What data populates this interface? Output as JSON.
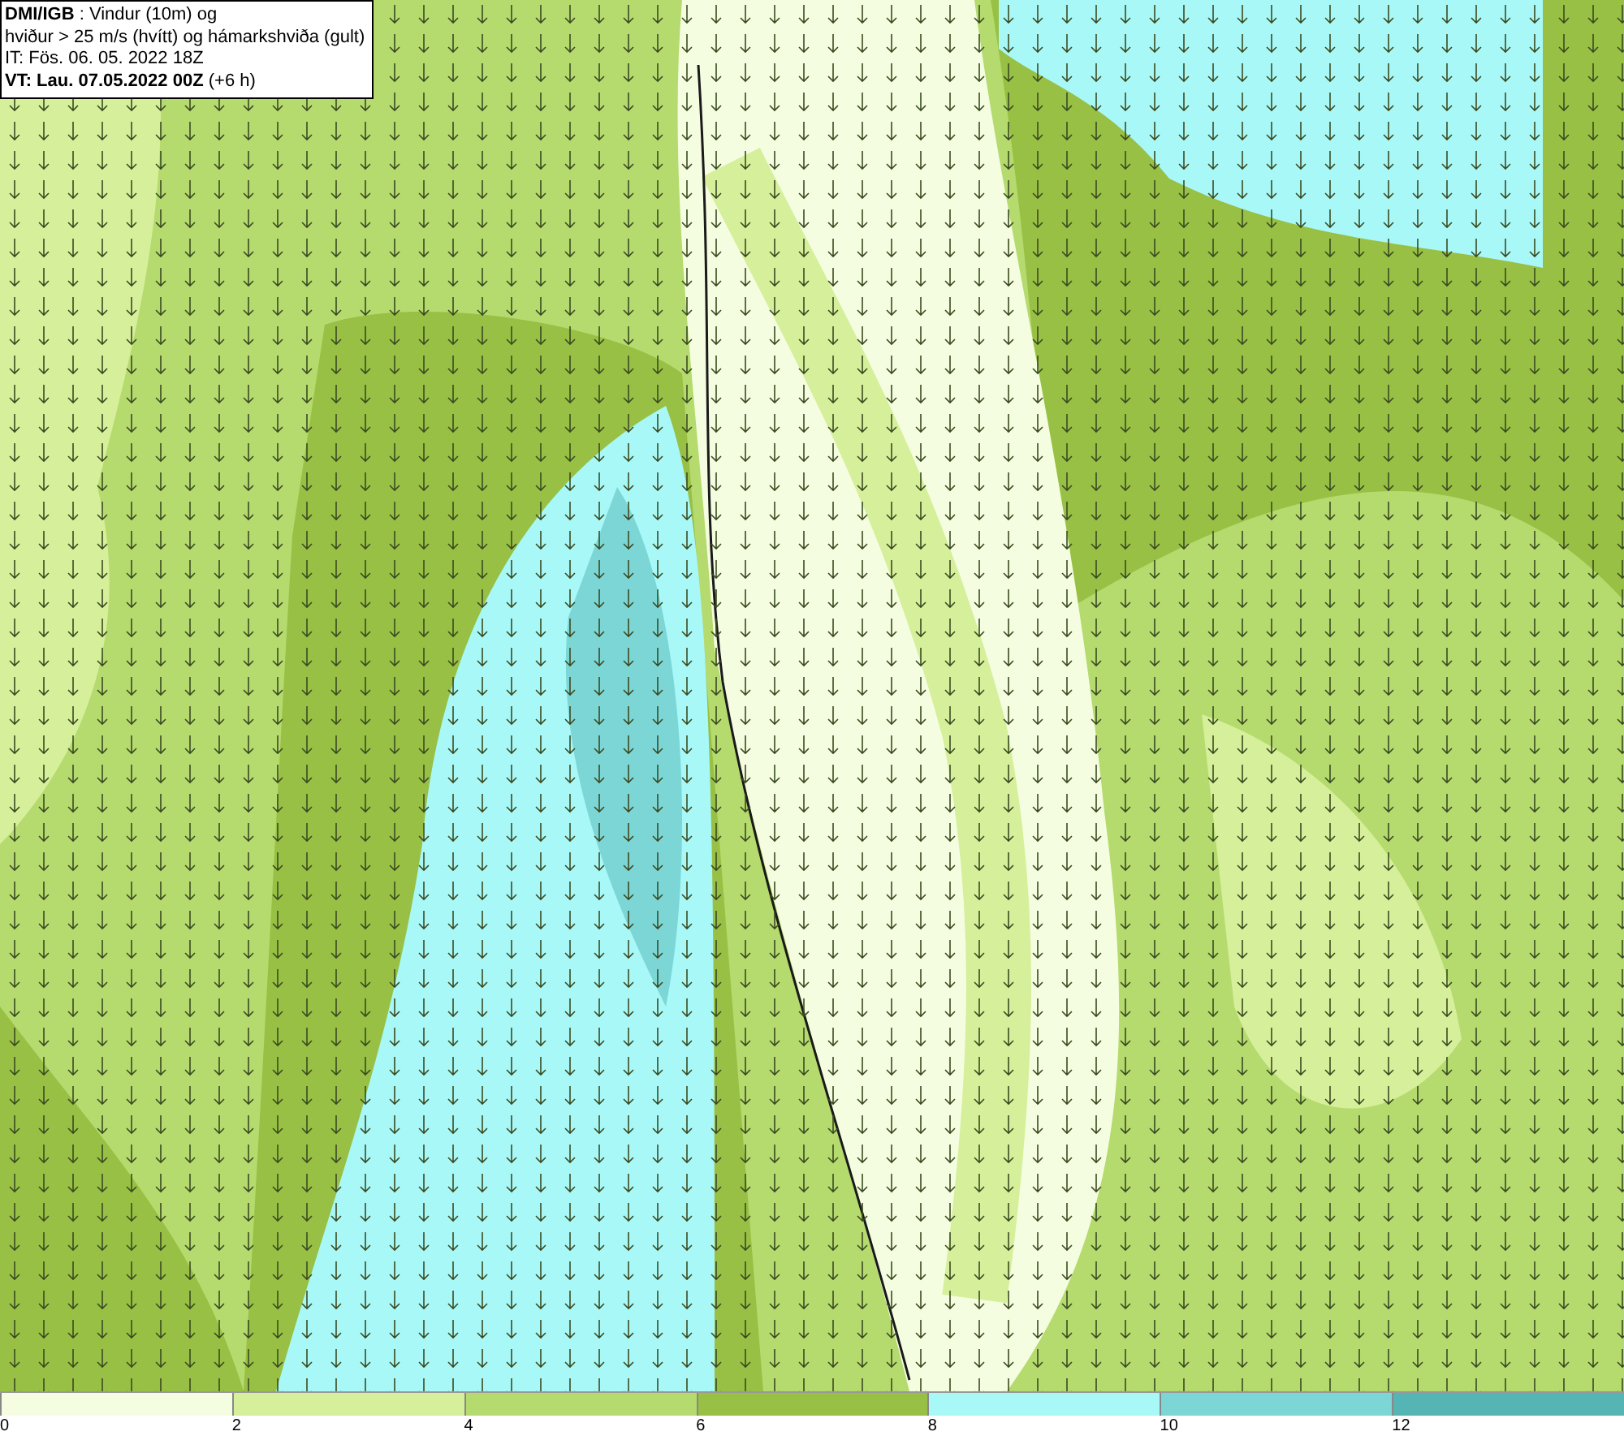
{
  "header": {
    "lines": [
      "**DMI/IGB** : Vindur (10m) og",
      "hviður > 25 m/s (hvítt) og hámarkshviða (gult)",
      "IT: Fös. 06. 05. 2022 18Z",
      "**VT: Lau. 07.05.2022 00Z** (+6 h)"
    ]
  },
  "legend": {
    "segments": [
      {
        "label": "0",
        "color": "#f4fde0"
      },
      {
        "label": "2",
        "color": "#d6ef9a"
      },
      {
        "label": "4",
        "color": "#b5da6e"
      },
      {
        "label": "6",
        "color": "#97c044"
      },
      {
        "label": "8",
        "color": "#a8f8f8"
      },
      {
        "label": "10",
        "color": "#7dd6d6"
      },
      {
        "label": "12",
        "color": "#55b5b5"
      }
    ]
  }
}
